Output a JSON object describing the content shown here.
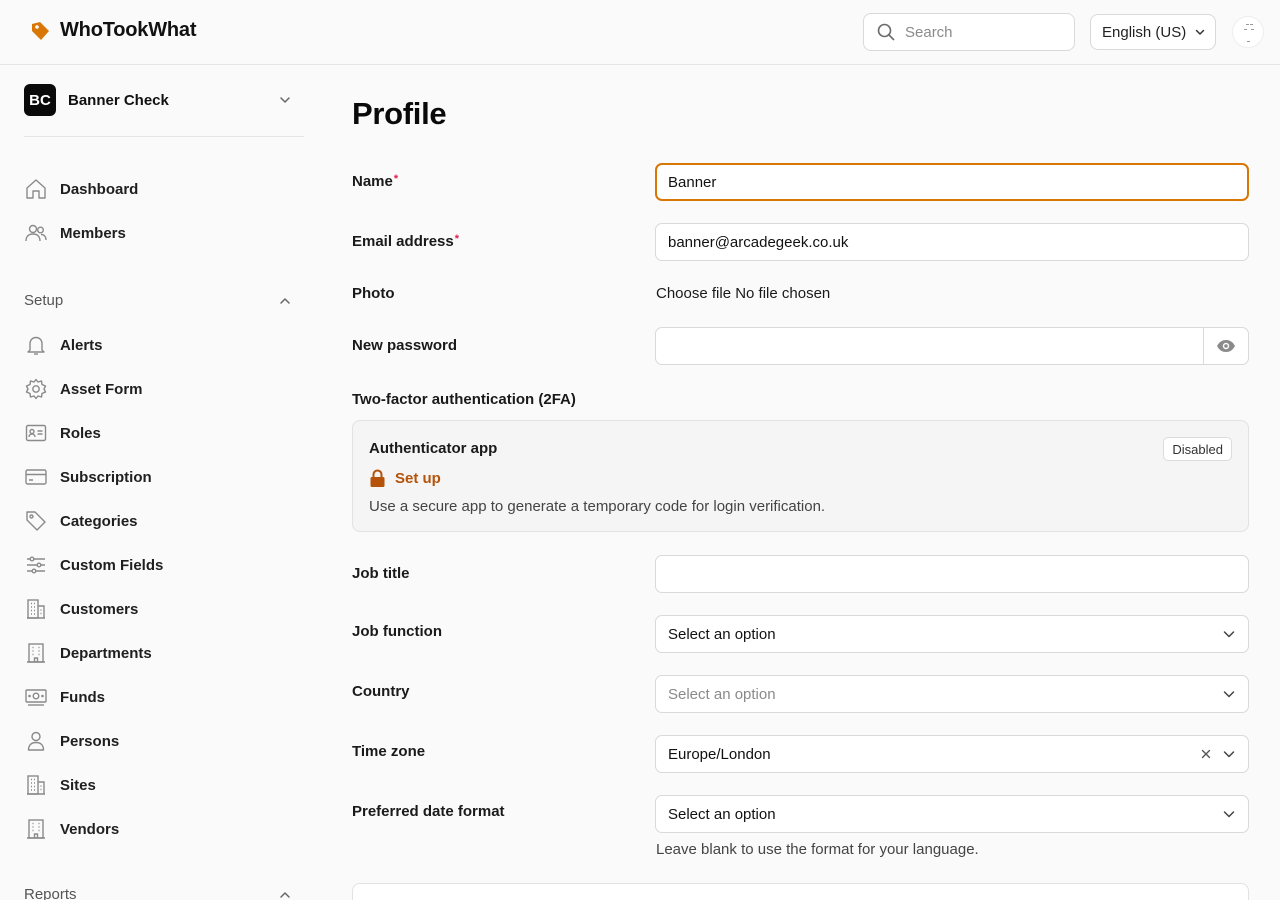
{
  "app": {
    "name": "WhoTookWhat",
    "brand_color": "#d97706",
    "logo_icon": "tag-icon"
  },
  "header": {
    "search_placeholder": "Search",
    "language": "English (US)"
  },
  "sidebar": {
    "org_initials": "BC",
    "org_name": "Banner Check",
    "items": [
      {
        "label": "Dashboard",
        "icon": "home-icon"
      },
      {
        "label": "Members",
        "icon": "users-icon"
      }
    ],
    "setup_label": "Setup",
    "setup_items": [
      {
        "label": "Alerts",
        "icon": "bell-icon"
      },
      {
        "label": "Asset Form",
        "icon": "gear-icon"
      },
      {
        "label": "Roles",
        "icon": "id-card-icon"
      },
      {
        "label": "Subscription",
        "icon": "credit-card-icon"
      },
      {
        "label": "Categories",
        "icon": "tag-icon"
      },
      {
        "label": "Custom Fields",
        "icon": "sliders-icon"
      },
      {
        "label": "Customers",
        "icon": "building-icon"
      },
      {
        "label": "Departments",
        "icon": "building-icon"
      },
      {
        "label": "Funds",
        "icon": "banknote-icon"
      },
      {
        "label": "Persons",
        "icon": "user-icon"
      },
      {
        "label": "Sites",
        "icon": "building-icon"
      },
      {
        "label": "Vendors",
        "icon": "building-icon"
      }
    ],
    "reports_label": "Reports"
  },
  "main": {
    "title": "Profile",
    "name_label": "Name",
    "name_value": "Banner",
    "email_label": "Email address",
    "email_value": "banner@arcadegeek.co.uk",
    "photo_label": "Photo",
    "photo_button": "Choose file",
    "photo_status": "No file chosen",
    "password_label": "New password",
    "tfa_label": "Two-factor authentication (2FA)",
    "tfa_card": {
      "title": "Authenticator app",
      "status": "Disabled",
      "action": "Set up",
      "description": "Use a secure app to generate a temporary code for login verification."
    },
    "job_title_label": "Job title",
    "job_function_label": "Job function",
    "job_function_value": "Select an option",
    "country_label": "Country",
    "country_placeholder": "Select an option",
    "timezone_label": "Time zone",
    "timezone_value": "Europe/London",
    "date_format_label": "Preferred date format",
    "date_format_value": "Select an option",
    "date_format_help": "Leave blank to use the format for your language."
  }
}
